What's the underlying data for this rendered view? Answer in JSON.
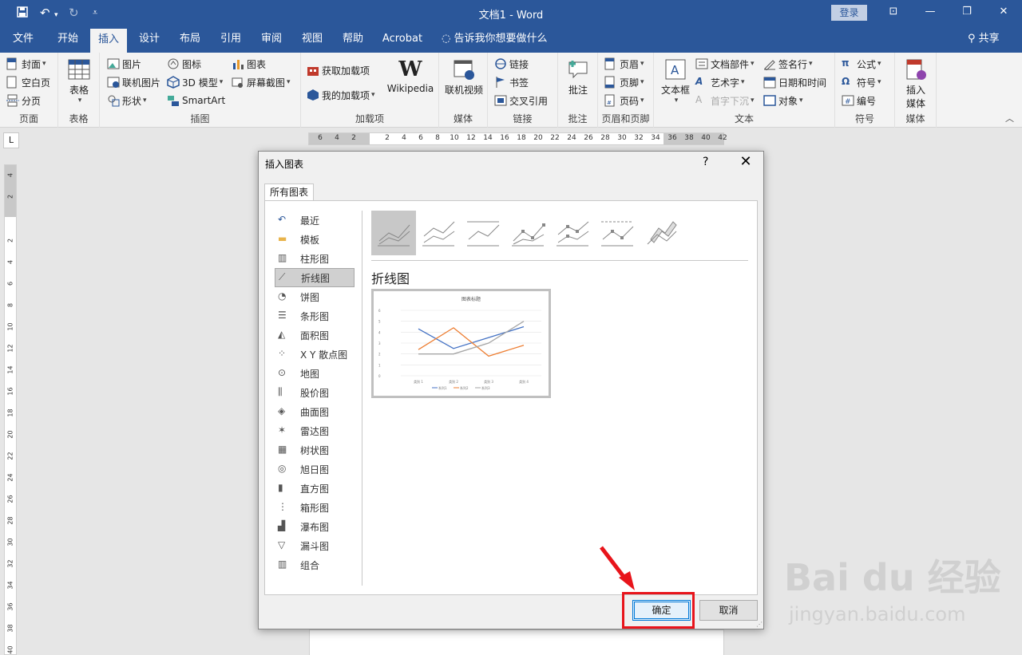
{
  "titlebar": {
    "title": "文档1  -  Word",
    "login": "登录"
  },
  "tabs": [
    "文件",
    "开始",
    "插入",
    "设计",
    "布局",
    "引用",
    "审阅",
    "视图",
    "帮助",
    "Acrobat"
  ],
  "active_tab": "插入",
  "tell_me": "告诉我你想要做什么",
  "share": "共享",
  "ribbon": {
    "page": {
      "label": "页面",
      "items": [
        "封面",
        "空白页",
        "分页"
      ]
    },
    "table": {
      "label": "表格",
      "button": "表格"
    },
    "illustrations": {
      "label": "插图",
      "items": [
        "图片",
        "联机图片",
        "形状",
        "图标",
        "3D 模型",
        "SmartArt",
        "图表",
        "屏幕截图"
      ]
    },
    "addins": {
      "label": "加载项",
      "items": [
        "获取加载项",
        "我的加载项"
      ],
      "wikipedia": "Wikipedia"
    },
    "media1": {
      "label": "媒体",
      "button": "联机视频"
    },
    "links": {
      "label": "链接",
      "items": [
        "链接",
        "书签",
        "交叉引用"
      ]
    },
    "comments": {
      "label": "批注",
      "button": "批注"
    },
    "header_footer": {
      "label": "页眉和页脚",
      "items": [
        "页眉",
        "页脚",
        "页码"
      ]
    },
    "text": {
      "label": "文本",
      "textbox": "文本框",
      "items": [
        "文档部件",
        "艺术字",
        "首字下沉",
        "签名行",
        "日期和时间",
        "对象"
      ]
    },
    "symbols": {
      "label": "符号",
      "items": [
        "公式",
        "符号",
        "编号"
      ]
    },
    "media2": {
      "label": "媒体",
      "button_l1": "插入",
      "button_l2": "媒体"
    }
  },
  "ruler": {
    "corner": "L",
    "h_ticks": [
      "6",
      "4",
      "2",
      "2",
      "4",
      "6",
      "8",
      "10",
      "12",
      "14",
      "16",
      "18",
      "20",
      "22",
      "24",
      "26",
      "28",
      "30",
      "32",
      "34",
      "36",
      "38",
      "40",
      "42"
    ],
    "v_ticks": [
      "4",
      "2",
      "2",
      "4",
      "6",
      "8",
      "10",
      "12",
      "14",
      "16",
      "18",
      "20",
      "22",
      "24",
      "26",
      "28",
      "30",
      "32",
      "34",
      "36",
      "38",
      "40"
    ]
  },
  "dialog": {
    "title": "插入图表",
    "help": "?",
    "close": "✕",
    "tab": "所有图表",
    "categories": [
      "最近",
      "模板",
      "柱形图",
      "折线图",
      "饼图",
      "条形图",
      "面积图",
      "X Y 散点图",
      "地图",
      "股价图",
      "曲面图",
      "雷达图",
      "树状图",
      "旭日图",
      "直方图",
      "箱形图",
      "瀑布图",
      "漏斗图",
      "组合"
    ],
    "selected_category": "折线图",
    "subtype_name": "折线图",
    "preview": {
      "title": "图表标题",
      "y_ticks": [
        "0",
        "1",
        "2",
        "3",
        "4",
        "5",
        "6"
      ],
      "categories": [
        "类别 1",
        "类别 2",
        "类别 3",
        "类别 4"
      ],
      "legend": [
        "系列1",
        "系列2",
        "系列3"
      ]
    },
    "ok": "确定",
    "cancel": "取消"
  },
  "chart_data": {
    "type": "line",
    "title": "图表标题",
    "categories": [
      "类别 1",
      "类别 2",
      "类别 3",
      "类别 4"
    ],
    "series": [
      {
        "name": "系列1",
        "values": [
          4.3,
          2.5,
          3.5,
          4.5
        ],
        "color": "#4472c4"
      },
      {
        "name": "系列2",
        "values": [
          2.4,
          4.4,
          1.8,
          2.8
        ],
        "color": "#ed7d31"
      },
      {
        "name": "系列3",
        "values": [
          2,
          2,
          3,
          5
        ],
        "color": "#a5a5a5"
      }
    ],
    "ylim": [
      0,
      6
    ]
  },
  "watermark": {
    "big": "Bai  du 经验",
    "small": "jingyan.baidu.com"
  },
  "colors": {
    "brand": "#2b579a",
    "highlight": "#e8141b"
  }
}
